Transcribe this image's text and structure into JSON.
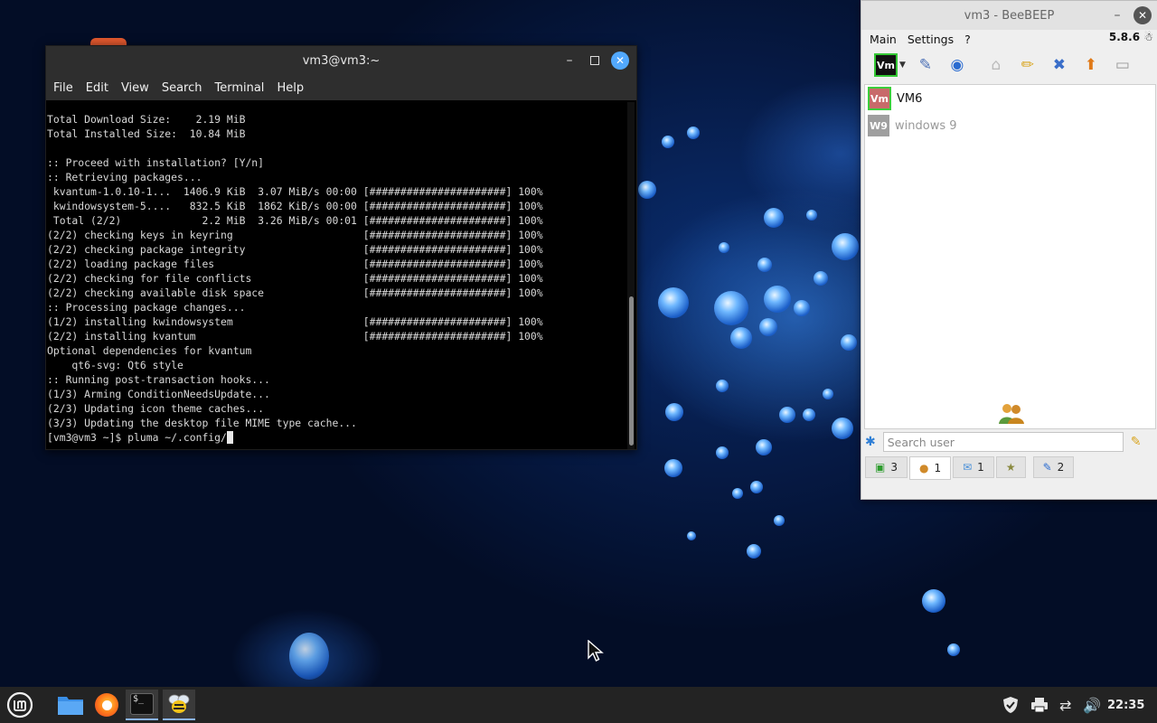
{
  "terminal": {
    "title": "vm3@vm3:~",
    "menu": [
      "File",
      "Edit",
      "View",
      "Search",
      "Terminal",
      "Help"
    ],
    "lines": [
      "Total Download Size:    2.19 MiB",
      "Total Installed Size:  10.84 MiB",
      "",
      ":: Proceed with installation? [Y/n]",
      ":: Retrieving packages...",
      " kvantum-1.0.10-1...  1406.9 KiB  3.07 MiB/s 00:00 [######################] 100%",
      " kwindowsystem-5....   832.5 KiB  1862 KiB/s 00:00 [######################] 100%",
      " Total (2/2)             2.2 MiB  3.26 MiB/s 00:01 [######################] 100%",
      "(2/2) checking keys in keyring                     [######################] 100%",
      "(2/2) checking package integrity                   [######################] 100%",
      "(2/2) loading package files                        [######################] 100%",
      "(2/2) checking for file conflicts                  [######################] 100%",
      "(2/2) checking available disk space                [######################] 100%",
      ":: Processing package changes...",
      "(1/2) installing kwindowsystem                     [######################] 100%",
      "(2/2) installing kvantum                           [######################] 100%",
      "Optional dependencies for kvantum",
      "    qt6-svg: Qt6 style",
      ":: Running post-transaction hooks...",
      "(1/3) Arming ConditionNeedsUpdate...",
      "(2/3) Updating icon theme caches...",
      "(3/3) Updating the desktop file MIME type cache..."
    ],
    "prompt": "[vm3@vm3 ~]$ pluma ~/.config/"
  },
  "beebeep": {
    "title": "vm3 - BeeBEEP",
    "menu": [
      "Main",
      "Settings",
      "?"
    ],
    "version": "5.8.6",
    "toolbar_vm_label": "Vm",
    "users": [
      {
        "initials": "Vm",
        "name": "VM6",
        "online": true
      },
      {
        "initials": "W9",
        "name": "windows 9",
        "online": false
      }
    ],
    "search_placeholder": "Search user",
    "tabs": [
      {
        "icon": "monitor-icon",
        "count": "3"
      },
      {
        "icon": "users-icon",
        "count": "1"
      },
      {
        "icon": "chat-icon",
        "count": "1"
      },
      {
        "icon": "group-icon",
        "count": ""
      },
      {
        "icon": "share-icon",
        "count": "2"
      }
    ]
  },
  "taskbar": {
    "clock": "22:35"
  },
  "colors": {
    "terminal_bg": "#000000",
    "titlebar": "#2e2e2e",
    "close_button": "#52a9ff",
    "taskbar": "#232323",
    "online_green": "#3ccd3c"
  }
}
